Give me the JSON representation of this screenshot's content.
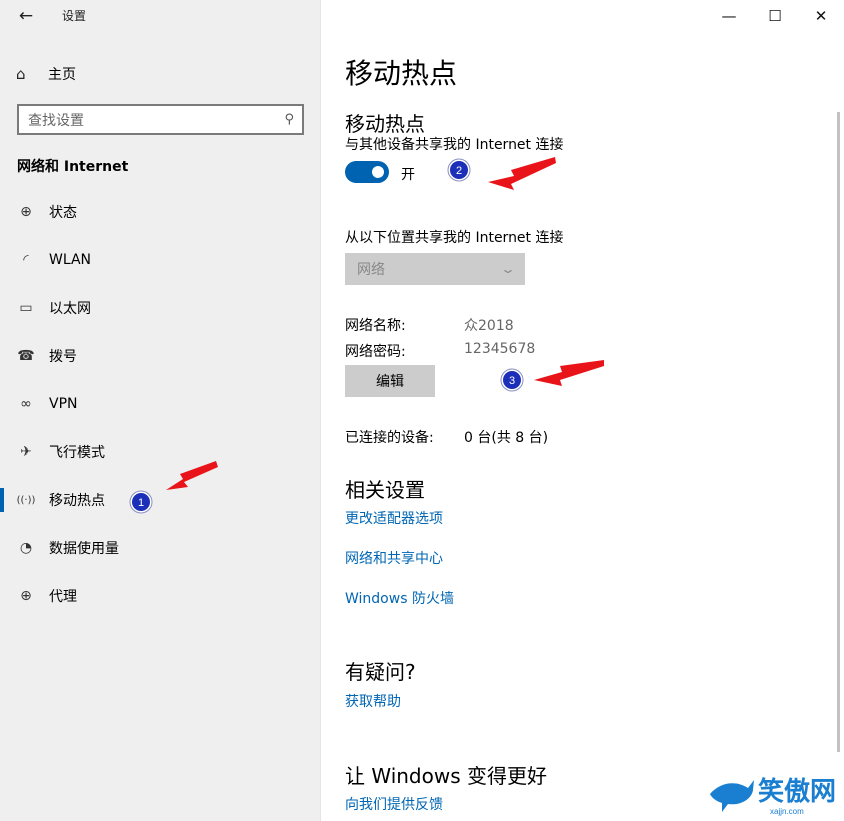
{
  "window": {
    "title": "设置",
    "controls": {
      "minimize": "—",
      "maximize": "☐",
      "close": "✕"
    }
  },
  "sidebar": {
    "back_icon": "←",
    "home": {
      "icon": "⌂",
      "label": "主页"
    },
    "search": {
      "placeholder": "查找设置",
      "icon": "⚲"
    },
    "section_header": "网络和 Internet",
    "items": [
      {
        "icon": "⊕",
        "label": "状态"
      },
      {
        "icon": "◜",
        "label": "WLAN"
      },
      {
        "icon": "▭",
        "label": "以太网"
      },
      {
        "icon": "☎",
        "label": "拨号"
      },
      {
        "icon": "∞",
        "label": "VPN"
      },
      {
        "icon": "✈",
        "label": "飞行模式"
      },
      {
        "icon": "((·))",
        "label": "移动热点"
      },
      {
        "icon": "◔",
        "label": "数据使用量"
      },
      {
        "icon": "⊕",
        "label": "代理"
      }
    ],
    "active_index": 6
  },
  "main": {
    "page_title": "移动热点",
    "hotspot": {
      "heading": "移动热点",
      "share_label": "与其他设备共享我的 Internet 连接",
      "toggle_state": "开",
      "toggle_on": true
    },
    "source": {
      "label": "从以下位置共享我的 Internet 连接",
      "selected": "网络"
    },
    "network": {
      "name_label": "网络名称:",
      "name_value": "众2018",
      "password_label": "网络密码:",
      "password_value": "12345678",
      "edit_button": "编辑"
    },
    "connected": {
      "label": "已连接的设备:",
      "value": "0 台(共 8 台)"
    },
    "related": {
      "heading": "相关设置",
      "links": [
        "更改适配器选项",
        "网络和共享中心",
        "Windows 防火墙"
      ]
    },
    "questions": {
      "heading": "有疑问?",
      "link": "获取帮助"
    },
    "feedback": {
      "heading": "让 Windows 变得更好",
      "link": "向我们提供反馈"
    }
  },
  "annotations": [
    {
      "number": "1"
    },
    {
      "number": "2"
    },
    {
      "number": "3"
    }
  ],
  "colors": {
    "accent": "#0063b1",
    "link": "#0066b4",
    "arrow": "#e8141a",
    "badge": "#1c2fb8"
  },
  "watermark": {
    "text": "笑傲网",
    "url": "xajjn.com"
  }
}
